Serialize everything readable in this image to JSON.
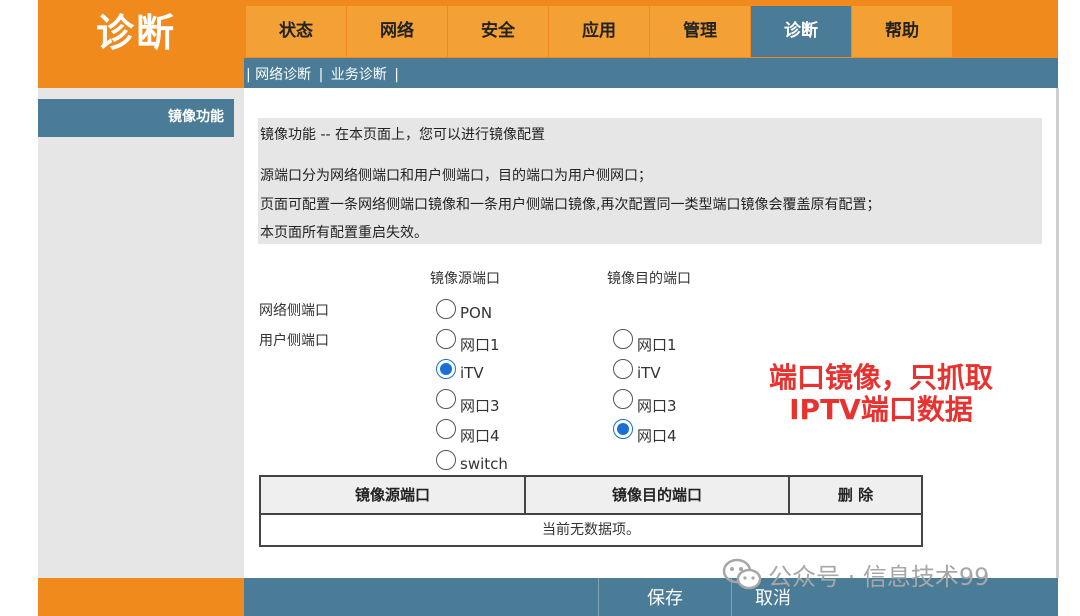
{
  "header": {
    "title": "诊断",
    "tabs": [
      {
        "label": "状态"
      },
      {
        "label": "网络"
      },
      {
        "label": "安全"
      },
      {
        "label": "应用"
      },
      {
        "label": "管理"
      },
      {
        "label": "诊断",
        "active": true
      },
      {
        "label": "帮助"
      }
    ],
    "subnav": {
      "sep_start": "|",
      "items": [
        "网络诊断",
        "业务诊断"
      ],
      "sep": "|"
    }
  },
  "sidebar": {
    "items": [
      {
        "label": "镜像功能",
        "active": true
      }
    ]
  },
  "info": {
    "title": "镜像功能 -- 在本页面上，您可以进行镜像配置",
    "lines": [
      "源端口分为网络侧端口和用户侧端口，目的端口为用户侧网口；",
      "页面可配置一条网络侧端口镜像和一条用户侧端口镜像,再次配置同一类型端口镜像会覆盖原有配置；",
      "本页面所有配置重启失效。"
    ]
  },
  "form": {
    "source_header": "镜像源端口",
    "dest_header": "镜像目的端口",
    "network_side_label": "网络侧端口",
    "user_side_label": "用户侧端口",
    "source_options": [
      {
        "label": "PON",
        "checked": false
      },
      {
        "label": "网口1",
        "checked": false
      },
      {
        "label": "iTV",
        "checked": true
      },
      {
        "label": "网口3",
        "checked": false
      },
      {
        "label": "网口4",
        "checked": false
      },
      {
        "label": "switch",
        "checked": false
      }
    ],
    "dest_options": [
      {
        "label": "网口1",
        "checked": false
      },
      {
        "label": "iTV",
        "checked": false
      },
      {
        "label": "网口3",
        "checked": false
      },
      {
        "label": "网口4",
        "checked": true
      }
    ]
  },
  "annotation": {
    "line1": "端口镜像，只抓取",
    "line2": "IPTV端口数据",
    "color": "#e8322f"
  },
  "table": {
    "headers": [
      "镜像源端口",
      "镜像目的端口",
      "删 除"
    ],
    "empty_text": "当前无数据项。"
  },
  "footer": {
    "save_label": "保存",
    "cancel_label": "取消"
  },
  "watermark": {
    "text": "公众号 · 信息技术99",
    "icon": "wechat-icon"
  },
  "colors": {
    "orange": "#f08a1c",
    "tab": "#f3a035",
    "steel_blue": "#4a7c98",
    "radio_checked": "#1a6fd6"
  }
}
